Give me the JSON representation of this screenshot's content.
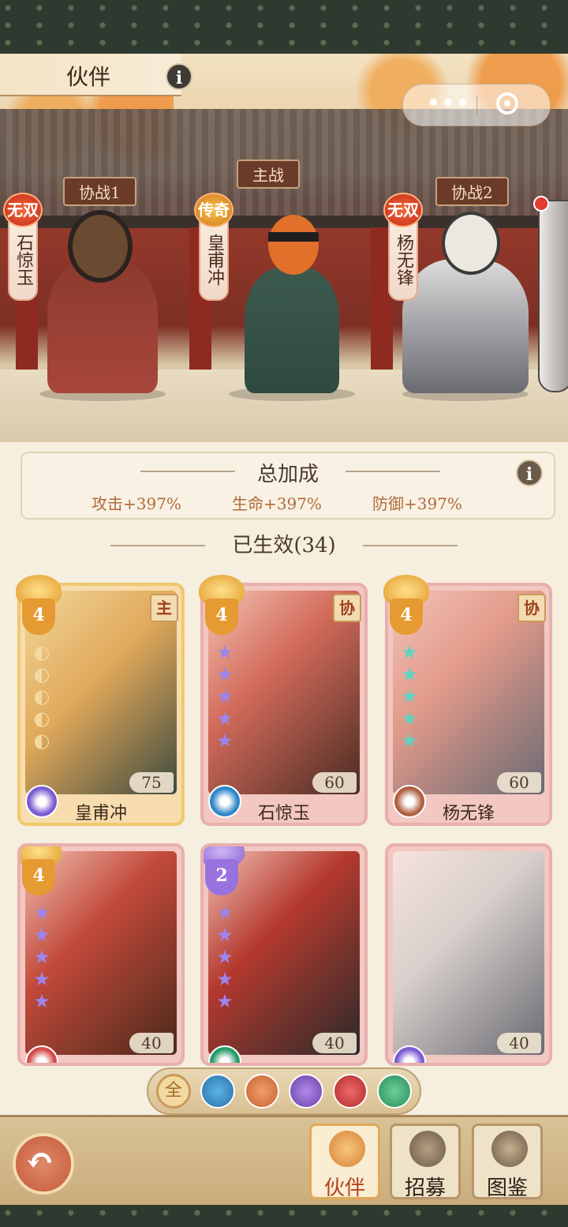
{
  "header": {
    "title": "伙伴",
    "info": "i"
  },
  "menu_capsule": {
    "more": "•••"
  },
  "formation": {
    "main_label": "主战",
    "assist1_label": "协战1",
    "assist2_label": "协战2",
    "left": {
      "badge": "无双",
      "name": "石惊玉"
    },
    "center": {
      "badge": "传奇",
      "name": "皇甫冲"
    },
    "right": {
      "badge": "无双",
      "name": "杨无锋"
    }
  },
  "bonus": {
    "title": "总加成",
    "info": "i",
    "attack": "攻击+397%",
    "health": "生命+397%",
    "defense": "防御+397%"
  },
  "active_title": "已生效(34)",
  "cards": [
    {
      "name": "皇甫冲",
      "level": "75",
      "rank": "4",
      "role": "主",
      "stars": 0,
      "frame": "gold"
    },
    {
      "name": "石惊玉",
      "level": "60",
      "rank": "4",
      "role": "协",
      "stars": 5,
      "frame": "pink"
    },
    {
      "name": "杨无锋",
      "level": "60",
      "rank": "4",
      "role": "协",
      "stars": 5,
      "frame": "pink"
    },
    {
      "name": "",
      "level": "40",
      "rank": "4",
      "role": "",
      "stars": 5,
      "frame": "pink"
    },
    {
      "name": "",
      "level": "40",
      "rank": "2",
      "role": "",
      "stars": 5,
      "frame": "pink"
    },
    {
      "name": "",
      "level": "40",
      "rank": "",
      "role": "",
      "stars": 0,
      "frame": "pink"
    }
  ],
  "filter": {
    "all": "全"
  },
  "nav": {
    "partner": "伙伴",
    "recruit": "招募",
    "codex": "图鉴",
    "back_glyph": "↶"
  },
  "colors": {
    "star_purple": "#9a86ee",
    "star_teal": "#5ed3c2",
    "accent_red": "#b3441c",
    "gold": "#f0c86e"
  }
}
